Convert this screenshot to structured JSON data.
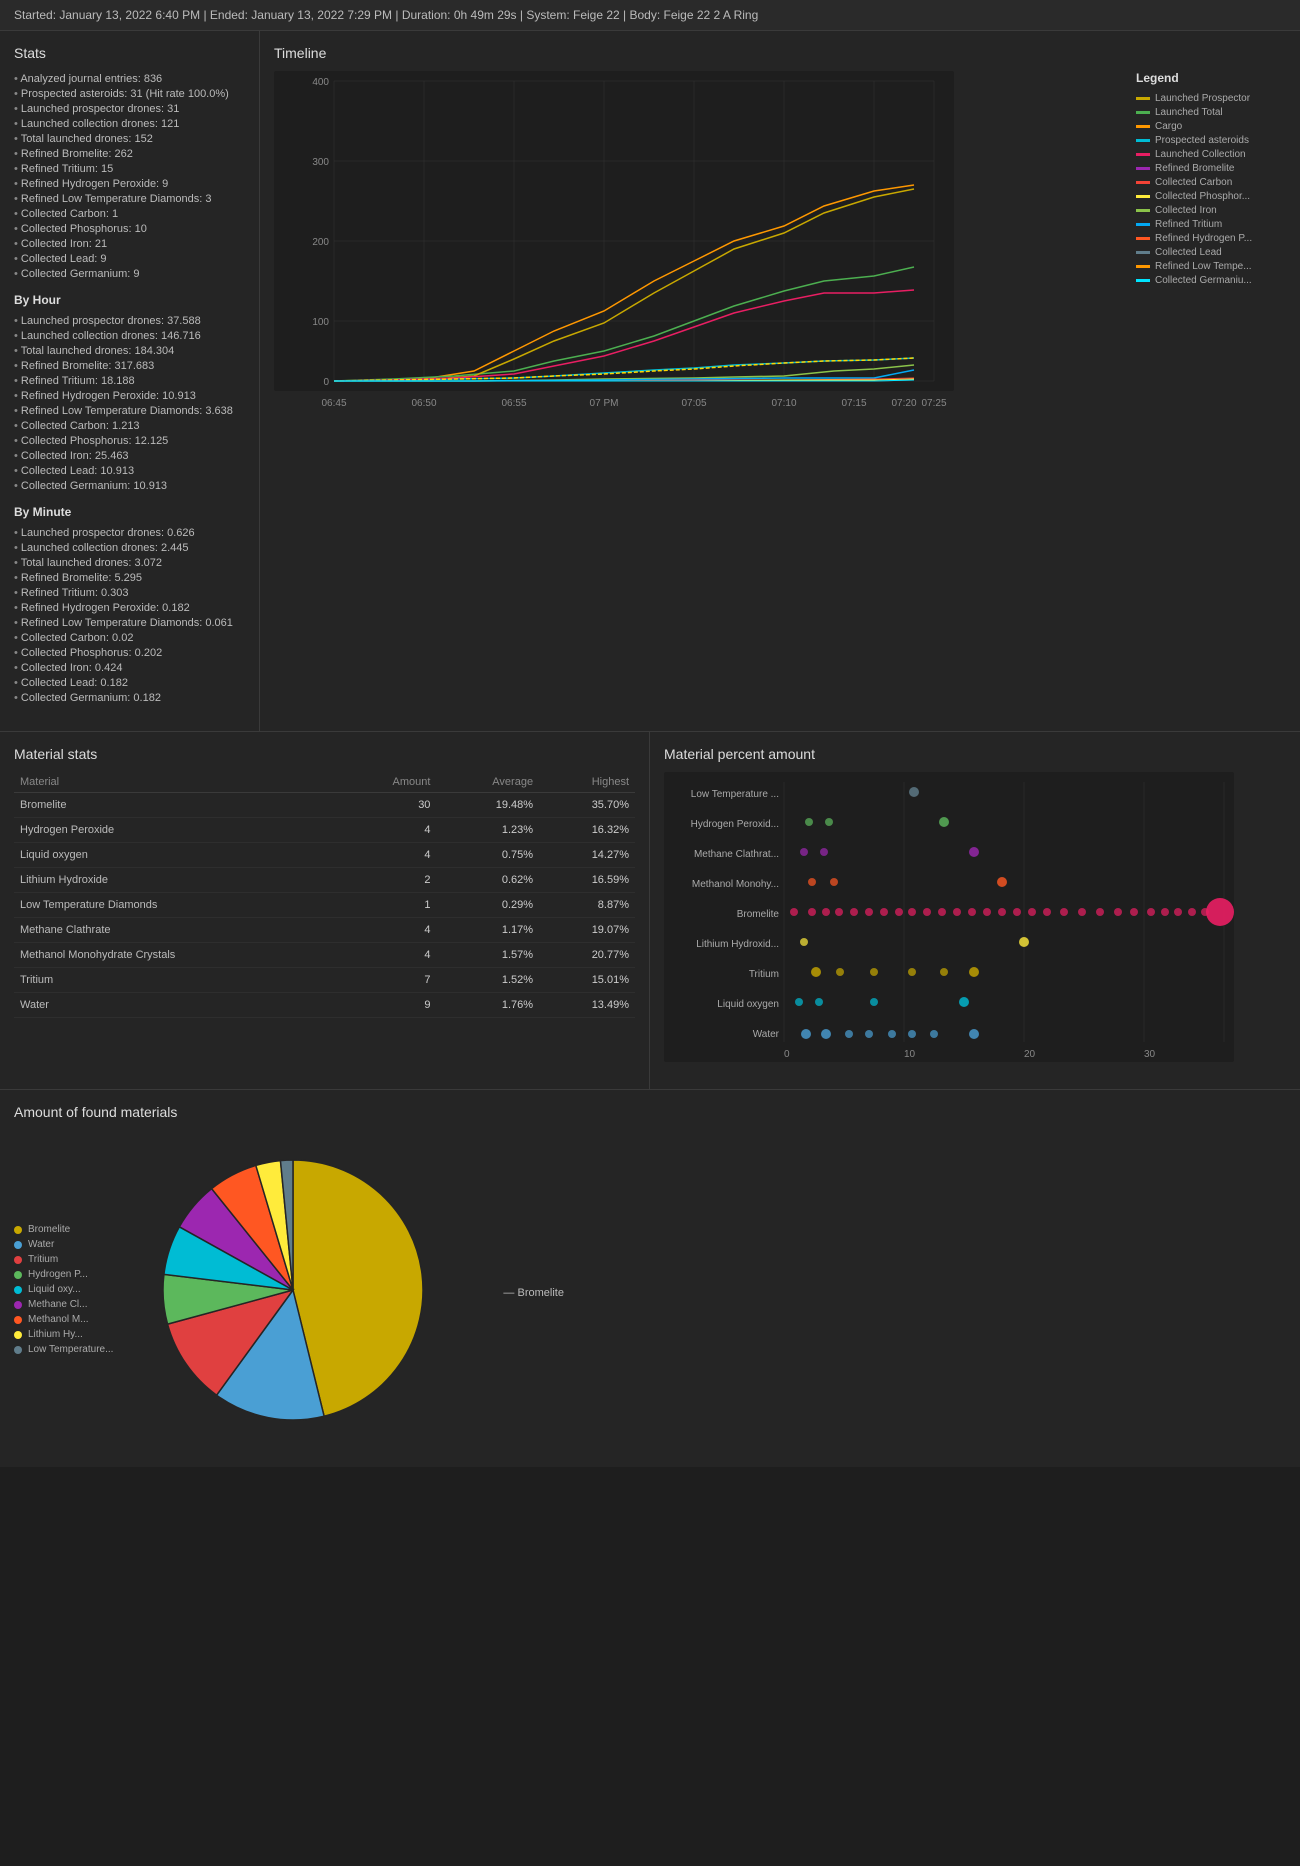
{
  "header": {
    "text": "Started: January 13, 2022 6:40 PM | Ended: January 13, 2022 7:29 PM | Duration: 0h 49m 29s | System: Feige 22 | Body: Feige 22 2 A Ring"
  },
  "stats": {
    "title": "Stats",
    "items": [
      "Analyzed journal entries: 836",
      "Prospected asteroids: 31 (Hit rate 100.0%)",
      "Launched prospector drones: 31",
      "Launched collection drones: 121",
      "Total launched drones: 152",
      "Refined Bromelite: 262",
      "Refined Tritium: 15",
      "Refined Hydrogen Peroxide: 9",
      "Refined Low Temperature Diamonds: 3",
      "Collected Carbon: 1",
      "Collected Phosphorus: 10",
      "Collected Iron: 21",
      "Collected Lead: 9",
      "Collected Germanium: 9"
    ],
    "byHour": {
      "label": "By Hour",
      "items": [
        "Launched prospector drones: 37.588",
        "Launched collection drones: 146.716",
        "Total launched drones: 184.304",
        "Refined Bromelite: 317.683",
        "Refined Tritium: 18.188",
        "Refined Hydrogen Peroxide: 10.913",
        "Refined Low Temperature Diamonds: 3.638",
        "Collected Carbon: 1.213",
        "Collected Phosphorus: 12.125",
        "Collected Iron: 25.463",
        "Collected Lead: 10.913",
        "Collected Germanium: 10.913"
      ]
    },
    "byMinute": {
      "label": "By Minute",
      "items": [
        "Launched prospector drones: 0.626",
        "Launched collection drones: 2.445",
        "Total launched drones: 3.072",
        "Refined Bromelite: 5.295",
        "Refined Tritium: 0.303",
        "Refined Hydrogen Peroxide: 0.182",
        "Refined Low Temperature Diamonds: 0.061",
        "Collected Carbon: 0.02",
        "Collected Phosphorus: 0.202",
        "Collected Iron: 0.424",
        "Collected Lead: 0.182",
        "Collected Germanium: 0.182"
      ]
    }
  },
  "timeline": {
    "title": "Timeline",
    "legend": {
      "title": "Legend",
      "items": [
        {
          "label": "Launched Prospector",
          "color": "#c8a800"
        },
        {
          "label": "Launched Total",
          "color": "#4CAF50"
        },
        {
          "label": "Cargo",
          "color": "#FF9800"
        },
        {
          "label": "Prospected asteroids",
          "color": "#00BCD4"
        },
        {
          "label": "Launched Collection",
          "color": "#E91E63"
        },
        {
          "label": "Refined Bromelite",
          "color": "#9C27B0"
        },
        {
          "label": "Collected Carbon",
          "color": "#F44336"
        },
        {
          "label": "Collected Phosphor...",
          "color": "#FFEB3B"
        },
        {
          "label": "Collected Iron",
          "color": "#8BC34A"
        },
        {
          "label": "Refined Tritium",
          "color": "#03A9F4"
        },
        {
          "label": "Refined Hydrogen P...",
          "color": "#FF5722"
        },
        {
          "label": "Collected Lead",
          "color": "#607D8B"
        },
        {
          "label": "Refined Low Tempe...",
          "color": "#FF9800"
        },
        {
          "label": "Collected Germaniu...",
          "color": "#00E5FF"
        }
      ]
    }
  },
  "materialStats": {
    "title": "Material stats",
    "columns": [
      "Material",
      "Amount",
      "Average",
      "Highest"
    ],
    "rows": [
      {
        "material": "Bromelite",
        "amount": "30",
        "average": "19.48%",
        "highest": "35.70%"
      },
      {
        "material": "Hydrogen Peroxide",
        "amount": "4",
        "average": "1.23%",
        "highest": "16.32%"
      },
      {
        "material": "Liquid oxygen",
        "amount": "4",
        "average": "0.75%",
        "highest": "14.27%"
      },
      {
        "material": "Lithium Hydroxide",
        "amount": "2",
        "average": "0.62%",
        "highest": "16.59%"
      },
      {
        "material": "Low Temperature Diamonds",
        "amount": "1",
        "average": "0.29%",
        "highest": "8.87%"
      },
      {
        "material": "Methane Clathrate",
        "amount": "4",
        "average": "1.17%",
        "highest": "19.07%"
      },
      {
        "material": "Methanol Monohydrate Crystals",
        "amount": "4",
        "average": "1.57%",
        "highest": "20.77%"
      },
      {
        "material": "Tritium",
        "amount": "7",
        "average": "1.52%",
        "highest": "15.01%"
      },
      {
        "material": "Water",
        "amount": "9",
        "average": "1.76%",
        "highest": "13.49%"
      }
    ]
  },
  "materialPercent": {
    "title": "Material percent amount"
  },
  "foundMaterials": {
    "title": "Amount of found materials",
    "items": [
      {
        "label": "Bromelite",
        "value": 30,
        "color": "#c8a800"
      },
      {
        "label": "Water",
        "value": 9,
        "color": "#4a9fd4"
      },
      {
        "label": "Tritium",
        "value": 7,
        "color": "#e04040"
      },
      {
        "label": "Hydrogen P...",
        "value": 4,
        "color": "#5cb85c"
      },
      {
        "label": "Liquid oxy...",
        "value": 4,
        "color": "#00bcd4"
      },
      {
        "label": "Methane Cl...",
        "value": 4,
        "color": "#9c27b0"
      },
      {
        "label": "Methanol M...",
        "value": 4,
        "color": "#ff5722"
      },
      {
        "label": "Lithium Hy...",
        "value": 2,
        "color": "#ffeb3b"
      },
      {
        "label": "Low Temperature...",
        "value": 1,
        "color": "#607d8b"
      }
    ]
  }
}
